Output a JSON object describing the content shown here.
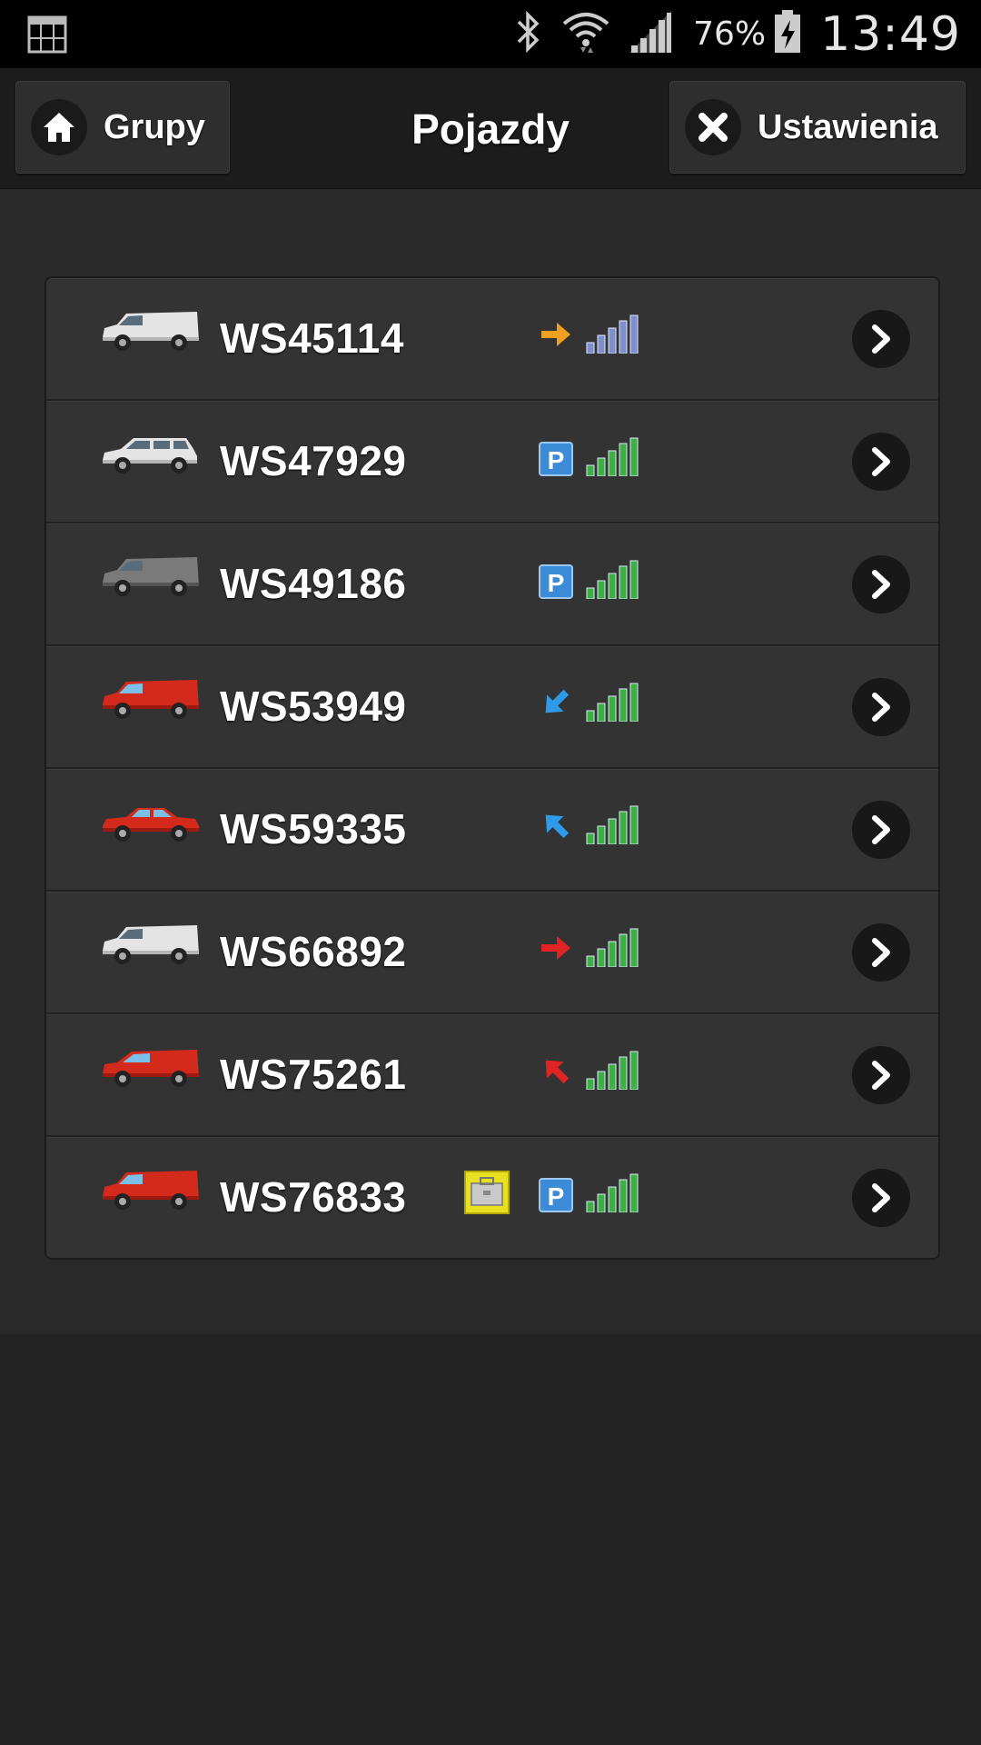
{
  "status_bar": {
    "battery_text": "76%",
    "time": "13:49"
  },
  "header": {
    "back_label": "Grupy",
    "title": "Pojazdy",
    "settings_label": "Ustawienia"
  },
  "vehicles": [
    {
      "plate": "WS45114",
      "vehicle_icon": "white-van-icon",
      "status": "arrow-right-orange",
      "parked": false,
      "bag": false,
      "signal_color": "#7f8fcc"
    },
    {
      "plate": "WS47929",
      "vehicle_icon": "white-minivan-icon",
      "status": "parking",
      "parked": true,
      "bag": false,
      "signal_color": "#3cb043"
    },
    {
      "plate": "WS49186",
      "vehicle_icon": "grey-van-icon",
      "status": "parking",
      "parked": true,
      "bag": false,
      "signal_color": "#3cb043"
    },
    {
      "plate": "WS53949",
      "vehicle_icon": "red-van-icon",
      "status": "arrow-down-left-blue",
      "parked": false,
      "bag": false,
      "signal_color": "#3cb043"
    },
    {
      "plate": "WS59335",
      "vehicle_icon": "red-sedan-icon",
      "status": "arrow-up-left-blue",
      "parked": false,
      "bag": false,
      "signal_color": "#3cb043"
    },
    {
      "plate": "WS66892",
      "vehicle_icon": "white-van-icon",
      "status": "arrow-right-red",
      "parked": false,
      "bag": false,
      "signal_color": "#3cb043"
    },
    {
      "plate": "WS75261",
      "vehicle_icon": "red-small-van-icon",
      "status": "arrow-up-left-red",
      "parked": false,
      "bag": false,
      "signal_color": "#3cb043"
    },
    {
      "plate": "WS76833",
      "vehicle_icon": "red-van-icon",
      "status": "parking",
      "parked": true,
      "bag": true,
      "signal_color": "#3cb043"
    }
  ]
}
